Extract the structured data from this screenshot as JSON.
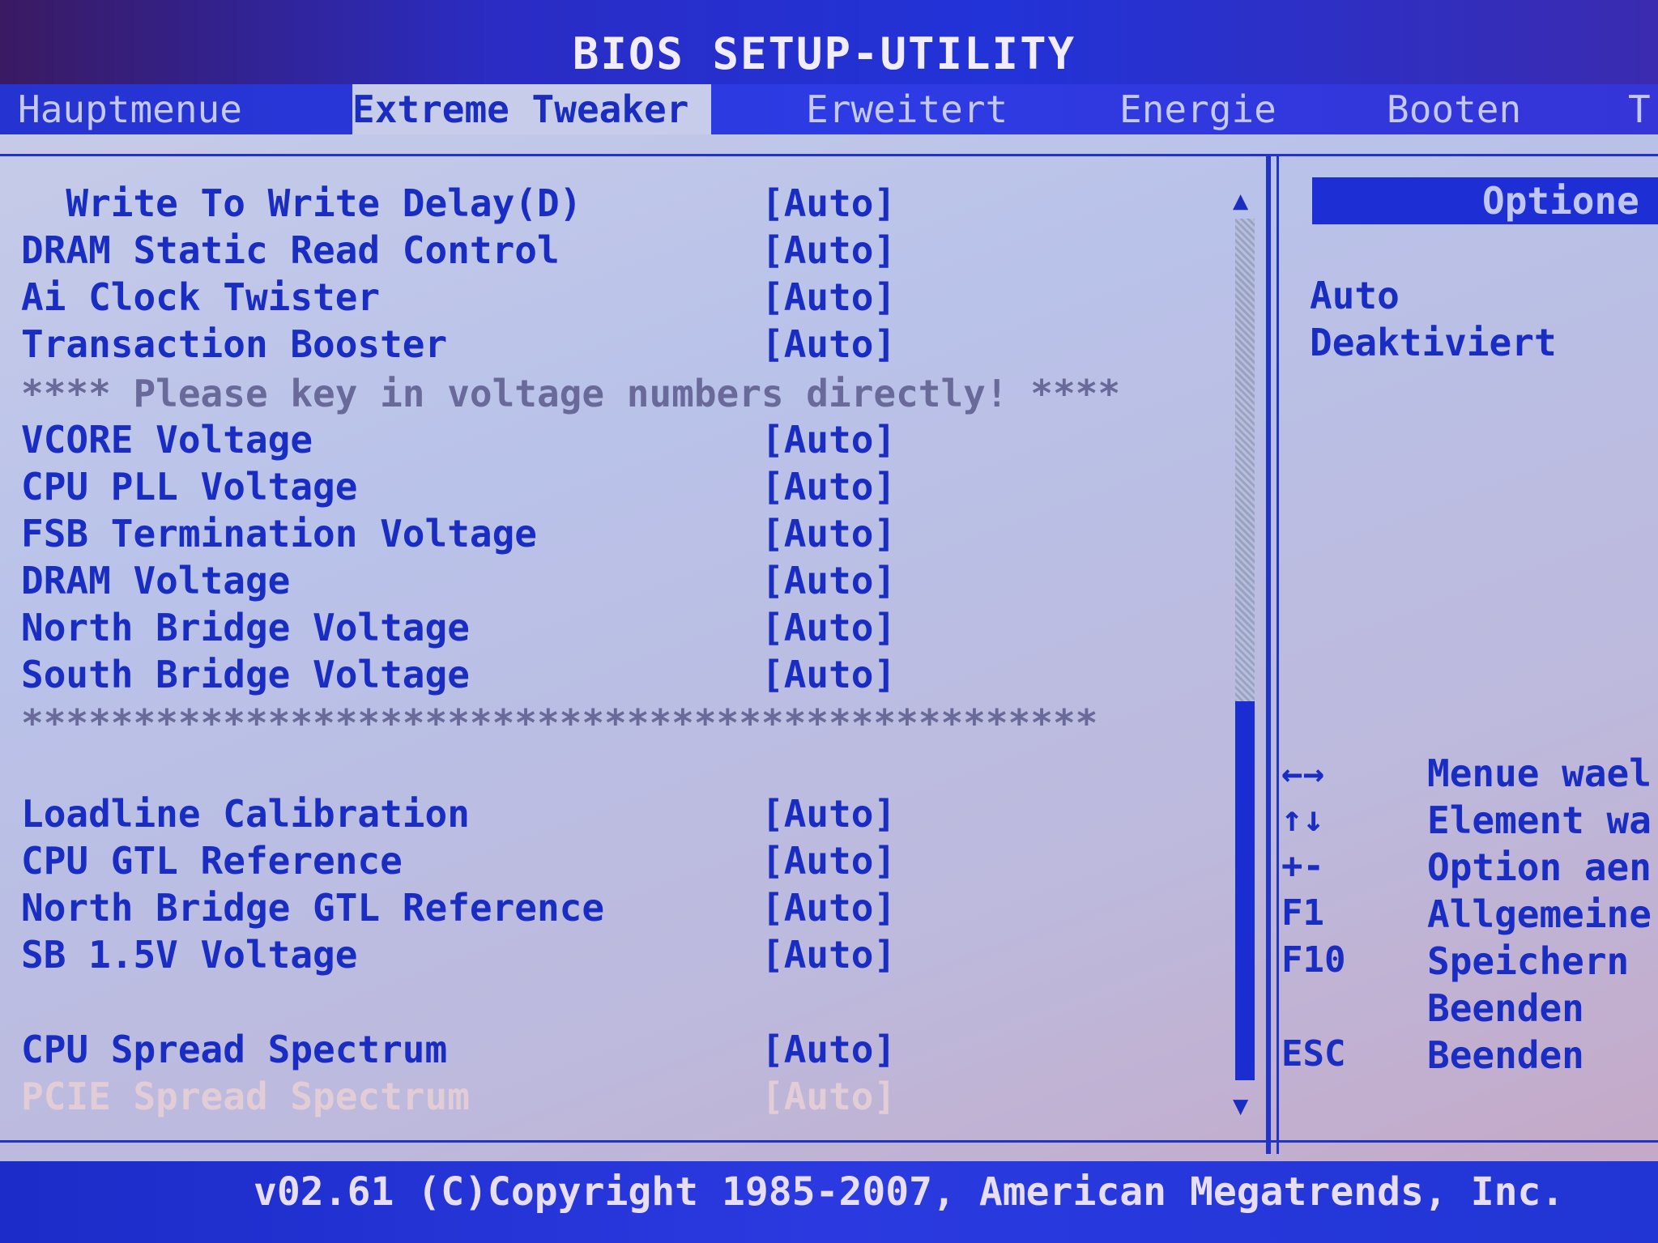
{
  "title": "BIOS SETUP-UTILITY",
  "tabs": [
    {
      "label": "Hauptmenue"
    },
    {
      "label": "Extreme Tweaker"
    },
    {
      "label": "Erweitert"
    },
    {
      "label": "Energie"
    },
    {
      "label": "Booten"
    },
    {
      "label": "T"
    }
  ],
  "settings": [
    {
      "label": "  Write To Write Delay(D)",
      "value": "[Auto]"
    },
    {
      "label": "DRAM Static Read Control",
      "value": "[Auto]"
    },
    {
      "label": "Ai Clock Twister",
      "value": "[Auto]"
    },
    {
      "label": "Transaction Booster",
      "value": "[Auto]"
    },
    {
      "label": "**** Please key in voltage numbers directly! ****"
    },
    {
      "label": "VCORE Voltage",
      "value": "[Auto]"
    },
    {
      "label": "CPU PLL Voltage",
      "value": "[Auto]"
    },
    {
      "label": "FSB Termination Voltage",
      "value": "[Auto]"
    },
    {
      "label": "DRAM Voltage",
      "value": "[Auto]"
    },
    {
      "label": "North Bridge Voltage",
      "value": "[Auto]"
    },
    {
      "label": "South Bridge Voltage",
      "value": "[Auto]"
    },
    {
      "label": "************************************************"
    },
    {
      "label": "Loadline Calibration",
      "value": "[Auto]"
    },
    {
      "label": "CPU GTL Reference",
      "value": "[Auto]"
    },
    {
      "label": "North Bridge GTL Reference",
      "value": "[Auto]"
    },
    {
      "label": "SB 1.5V Voltage",
      "value": "[Auto]"
    },
    {
      "label": "CPU Spread Spectrum",
      "value": "[Auto]"
    },
    {
      "label": "PCIE Spread Spectrum",
      "value": "[Auto]"
    }
  ],
  "options": {
    "header": "Optione",
    "items": [
      "Auto",
      "Deaktiviert"
    ]
  },
  "help": [
    {
      "key": "←→",
      "desc": "Menue wael"
    },
    {
      "key": "↑↓",
      "desc": "Element wa"
    },
    {
      "key": "+-",
      "desc": "Option aen"
    },
    {
      "key": "F1",
      "desc": "Allgemeine"
    },
    {
      "key": "F10",
      "desc": "Speichern"
    },
    {
      "key": "",
      "desc": "Beenden"
    },
    {
      "key": "ESC",
      "desc": "Beenden"
    }
  ],
  "footer": "v02.61 (C)Copyright 1985-2007, American Megatrends, Inc."
}
